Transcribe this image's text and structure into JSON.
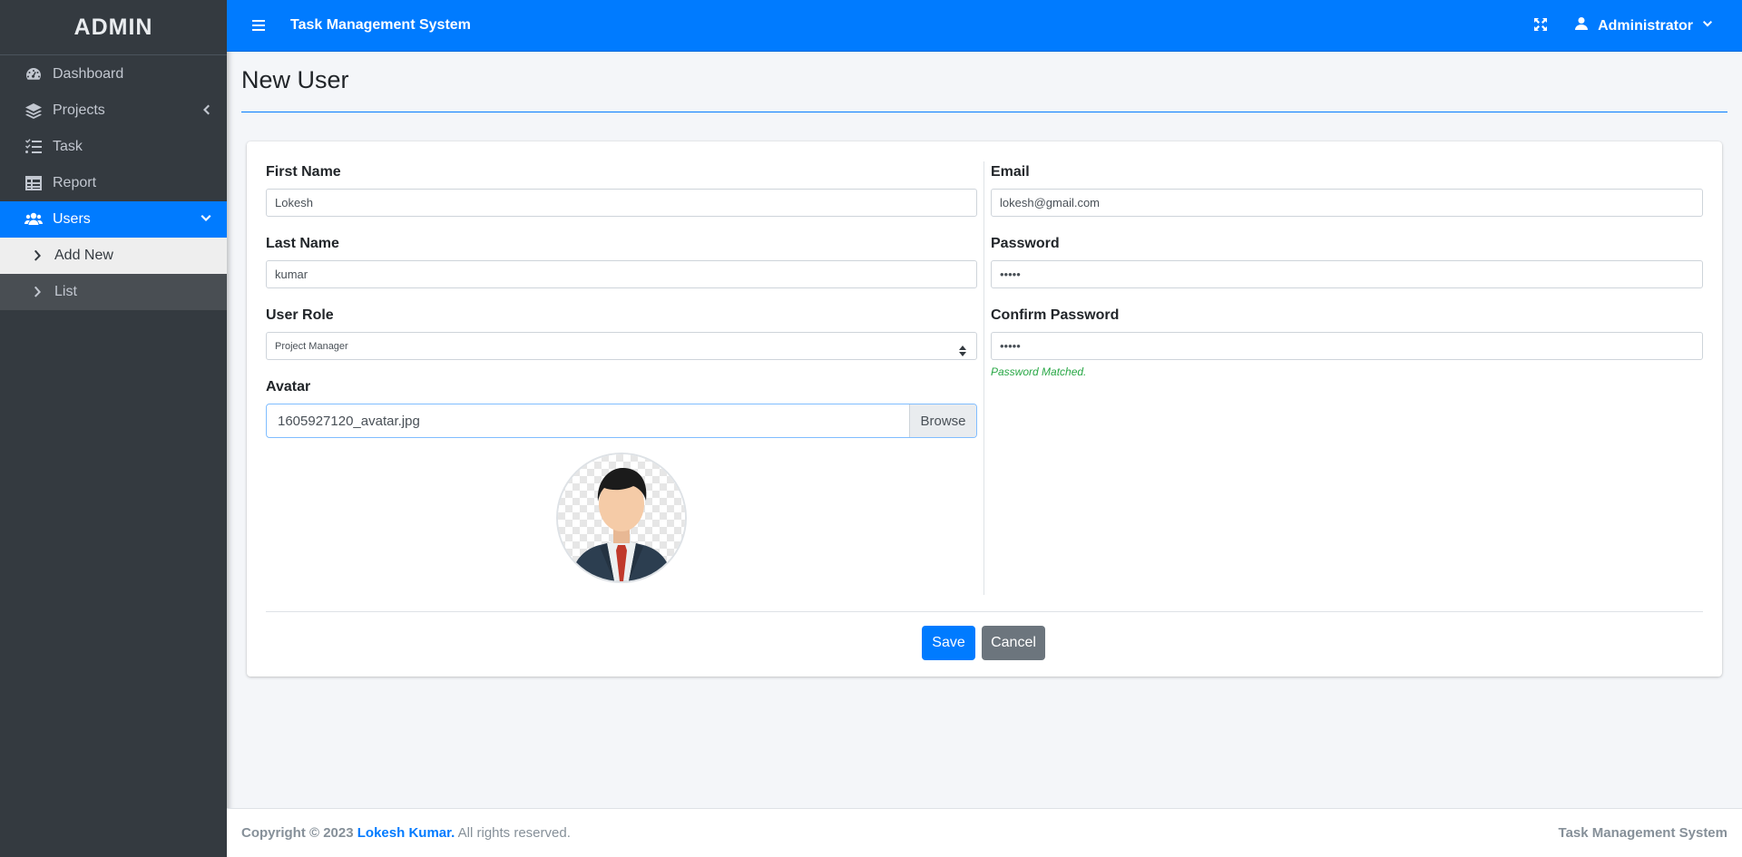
{
  "brand": "ADMIN",
  "header": {
    "app_title": "Task Management System",
    "user_name": "Administrator"
  },
  "sidebar": {
    "items": [
      {
        "label": "Dashboard",
        "icon": "tachometer-icon"
      },
      {
        "label": "Projects",
        "icon": "layers-icon"
      },
      {
        "label": "Task",
        "icon": "tasks-icon"
      },
      {
        "label": "Report",
        "icon": "table-icon"
      },
      {
        "label": "Users",
        "icon": "users-icon"
      }
    ],
    "sub_items": [
      {
        "label": "Add New"
      },
      {
        "label": "List"
      }
    ]
  },
  "page": {
    "title": "New User"
  },
  "form": {
    "first_name": {
      "label": "First Name",
      "value": "Lokesh"
    },
    "last_name": {
      "label": "Last Name",
      "value": "kumar"
    },
    "user_role": {
      "label": "User Role",
      "value": "Project Manager"
    },
    "avatar": {
      "label": "Avatar",
      "file": "1605927120_avatar.jpg",
      "browse": "Browse"
    },
    "email": {
      "label": "Email",
      "value": "lokesh@gmail.com"
    },
    "password": {
      "label": "Password",
      "value": "•••••"
    },
    "confirm_password": {
      "label": "Confirm Password",
      "value": "•••••",
      "hint": "Password Matched."
    }
  },
  "buttons": {
    "save": "Save",
    "cancel": "Cancel"
  },
  "footer": {
    "copyright_prefix": "Copyright © 2023",
    "author": "Lokesh Kumar.",
    "rights": "All rights reserved.",
    "right_text": "Task Management System"
  },
  "colors": {
    "primary": "#007bff",
    "sidebar": "#343a40",
    "success": "#28a745",
    "secondary": "#6c757d"
  }
}
